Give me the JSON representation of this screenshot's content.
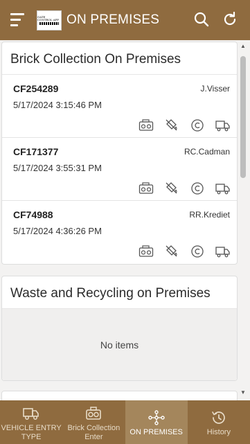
{
  "header": {
    "title": "ON PREMISES",
    "logo_text": "GATE CONTROL APP"
  },
  "brick_section": {
    "title": "Brick Collection On Premises",
    "items": [
      {
        "id": "CF254289",
        "user": "J.Visser",
        "datetime": "5/17/2024 3:15:46 PM"
      },
      {
        "id": "CF171377",
        "user": "RC.Cadman",
        "datetime": "5/17/2024 3:55:31 PM"
      },
      {
        "id": "CF74988",
        "user": "RR.Krediet",
        "datetime": "5/17/2024 4:36:26 PM"
      }
    ]
  },
  "waste_section": {
    "title": "Waste and Recycling on Premises",
    "empty_text": "No items"
  },
  "bottom_nav": {
    "items": [
      {
        "label": "VEHICLE ENTRY TYPE",
        "icon": "truck-icon"
      },
      {
        "label": "Brick Collection Enter",
        "icon": "brick-collection-icon"
      },
      {
        "label": "ON PREMISES",
        "icon": "network-icon"
      },
      {
        "label": "History",
        "icon": "history-icon"
      }
    ],
    "active_index": 2
  },
  "colors": {
    "primary": "#8f6b3f",
    "active_tab": "#a4865c"
  }
}
